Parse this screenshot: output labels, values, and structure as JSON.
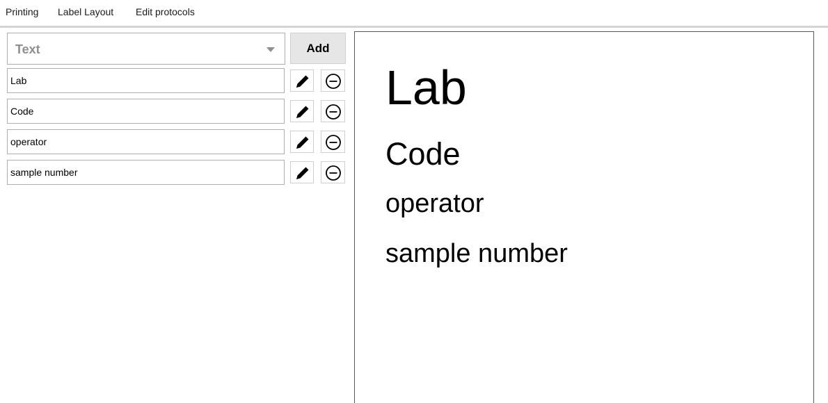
{
  "tabs": [
    {
      "label": "Printing",
      "active": false
    },
    {
      "label": "Label Layout",
      "active": true
    },
    {
      "label": "Edit protocols",
      "active": false
    }
  ],
  "colors": {
    "tab_indicator": "#1aa3d4",
    "placeholder_text": "#8f8f8f",
    "add_button_bg": "#e6e6e6"
  },
  "element_type_select": {
    "selected": "Text"
  },
  "add_button": {
    "label": "Add"
  },
  "fields": [
    {
      "value": "Lab",
      "edit_icon": "pencil-icon",
      "remove_icon": "minus-circle-icon"
    },
    {
      "value": "Code",
      "edit_icon": "pencil-icon",
      "remove_icon": "minus-circle-icon"
    },
    {
      "value": "operator",
      "edit_icon": "pencil-icon",
      "remove_icon": "minus-circle-icon"
    },
    {
      "value": "sample number",
      "edit_icon": "pencil-icon",
      "remove_icon": "minus-circle-icon"
    }
  ],
  "preview": {
    "lines": [
      "Lab",
      "Code",
      "operator",
      "sample number"
    ]
  }
}
